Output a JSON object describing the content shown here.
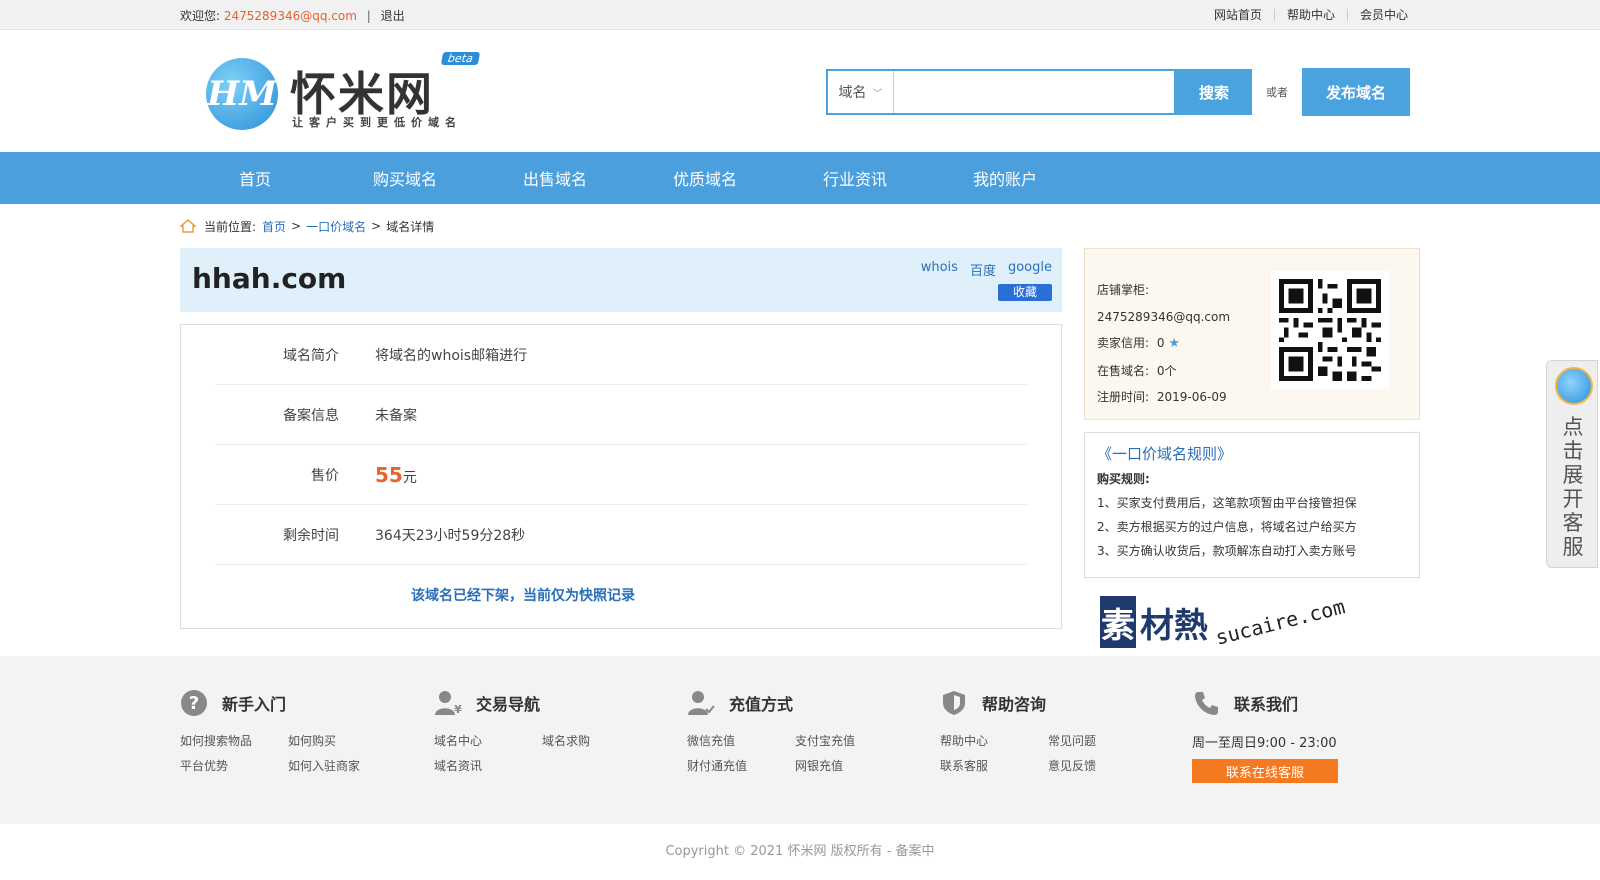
{
  "topbar": {
    "welcome": "欢迎您:",
    "email": "2475289346@qq.com",
    "sep": "|",
    "logout": "退出",
    "links": [
      "网站首页",
      "帮助中心",
      "会员中心"
    ]
  },
  "logo": {
    "text": "怀米网",
    "badge": "beta",
    "slogan": "让客户买到更低价域名",
    "mark": "HM"
  },
  "search": {
    "type_label": "域名",
    "placeholder": "",
    "button": "搜索",
    "or": "或者",
    "publish": "发布域名"
  },
  "nav": [
    "首页",
    "购买域名",
    "出售域名",
    "优质域名",
    "行业资讯",
    "我的账户"
  ],
  "breadcrumb": {
    "prefix": "当前位置:",
    "home": "首页",
    "category": "一口价域名",
    "current": "域名详情",
    "gt": ">"
  },
  "domain": {
    "name": "hhah.com",
    "links": [
      "whois",
      "百度",
      "google"
    ],
    "favorite": "收藏"
  },
  "info": {
    "rows": [
      {
        "label": "域名简介",
        "value": "将域名的whois邮箱进行"
      },
      {
        "label": "备案信息",
        "value": "未备案"
      },
      {
        "label": "售价",
        "price": "55",
        "unit": "元"
      },
      {
        "label": "剩余时间",
        "value": "364天23小时59分28秒"
      }
    ],
    "offline_notice": "该域名已经下架，当前仅为快照记录"
  },
  "shop": {
    "owner_label": "店铺掌柜:",
    "owner": "2475289346@qq.com",
    "credit_label": "卖家信用:",
    "credit": "0",
    "selling_label": "在售域名:",
    "selling": "0个",
    "reg_label": "注册时间:",
    "reg": "2019-06-09"
  },
  "rules": {
    "title": "《一口价域名规则》",
    "subtitle": "购买规则:",
    "items": [
      "1、买家支付费用后，这笔款项暂由平台接管担保",
      "2、卖方根据买方的过户信息，将域名过户给买方",
      "3、买方确认收货后，款项解冻自动打入卖方账号"
    ]
  },
  "watermark": {
    "badge": "素",
    "text": "材熱",
    "url": "sucaire.com"
  },
  "footer": {
    "cols": [
      {
        "title": "新手入门",
        "links": [
          "如何搜索物品",
          "如何购买",
          "平台优势",
          "如何入驻商家"
        ]
      },
      {
        "title": "交易导航",
        "links": [
          "域名中心",
          "域名求购",
          "域名资讯"
        ]
      },
      {
        "title": "充值方式",
        "links": [
          "微信充值",
          "支付宝充值",
          "财付通充值",
          "网银充值"
        ]
      },
      {
        "title": "帮助咨询",
        "links": [
          "帮助中心",
          "常见问题",
          "联系客服",
          "意见反馈"
        ]
      }
    ],
    "contact": {
      "title": "联系我们",
      "hours": "周一至周日9:00 - 23:00",
      "button": "联系在线客服"
    }
  },
  "copyright": "Copyright © 2021 怀米网 版权所有 - 备案中",
  "side_service": "点击展开客服",
  "colors": {
    "primary": "#4a9fdc",
    "accent": "#e8632b",
    "link": "#2a6fb8",
    "contact_button": "#f47920"
  }
}
